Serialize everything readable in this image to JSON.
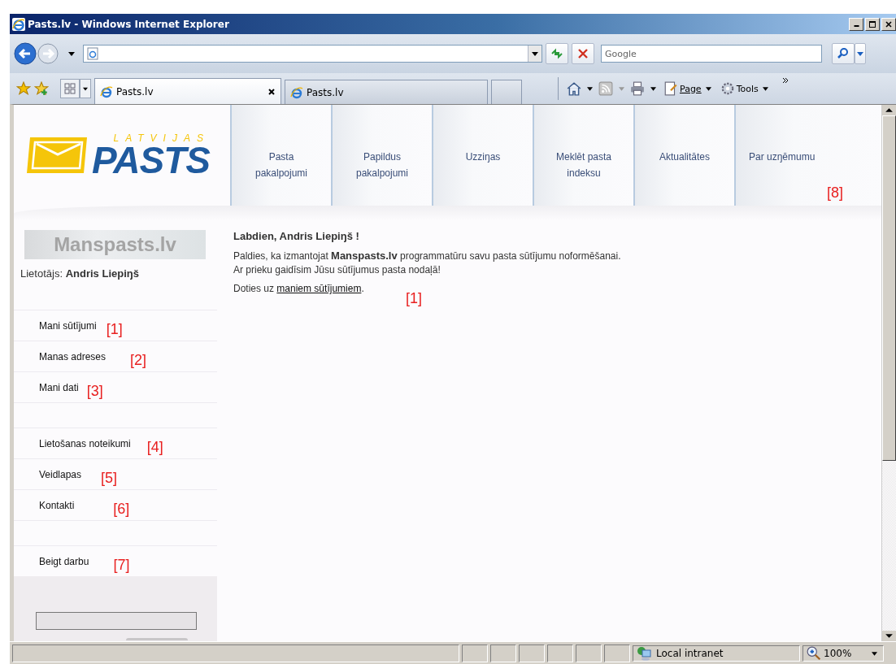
{
  "window": {
    "title": "Pasts.lv - Windows Internet Explorer"
  },
  "search": {
    "placeholder": "Google"
  },
  "tabs": [
    {
      "label": "Pasts.lv",
      "selected": true
    },
    {
      "label": "Pasts.lv",
      "selected": false
    }
  ],
  "command_bar": {
    "page": "Page",
    "tools": "Tools"
  },
  "site": {
    "logo_top": "LATVIJAS",
    "logo_main": "PASTS",
    "nav": [
      {
        "label": "Pasta pakalpojumi"
      },
      {
        "label": "Papildus pakalpojumi"
      },
      {
        "label": "Uzziŋas"
      },
      {
        "label": "Meklēt pasta indeksu"
      },
      {
        "label": "Aktualitātes"
      },
      {
        "label": "Par uzŋēmumu",
        "marker": "[8]"
      }
    ]
  },
  "sidebar": {
    "banner": "Manspasts.lv",
    "user_label": "Lietotājs:",
    "user_name": "Andris Liepiŋš",
    "groups": [
      [
        {
          "label": "Mani sūtījumi",
          "marker": "[1]"
        },
        {
          "label": "Manas adreses",
          "marker": "[2]"
        },
        {
          "label": "Mani dati",
          "marker": "[3]"
        }
      ],
      [
        {
          "label": "Lietošanas noteikumi",
          "marker": "[4]"
        },
        {
          "label": "Veidlapas",
          "marker": "[5]"
        },
        {
          "label": "Kontakti",
          "marker": "[6]"
        }
      ],
      [
        {
          "label": "Beigt darbu",
          "marker": "[7]"
        }
      ]
    ]
  },
  "main": {
    "greeting": "Labdien, Andris Liepiŋš !",
    "lines": [
      "Paldies, ka izmantojat **Manspasts.lv** programmatūru savu pasta sūtījumu noformēšanai.",
      "Ar prieku gaidīsim Jūsu sūtījumus pasta nodaļā!"
    ],
    "goto_prefix": "Doties uz",
    "goto_link": "maniem sūtījumiem",
    "goto_suffix": ".",
    "marker": "[1]"
  },
  "status_bar": {
    "zone": "Local intranet",
    "zoom": "100%"
  }
}
